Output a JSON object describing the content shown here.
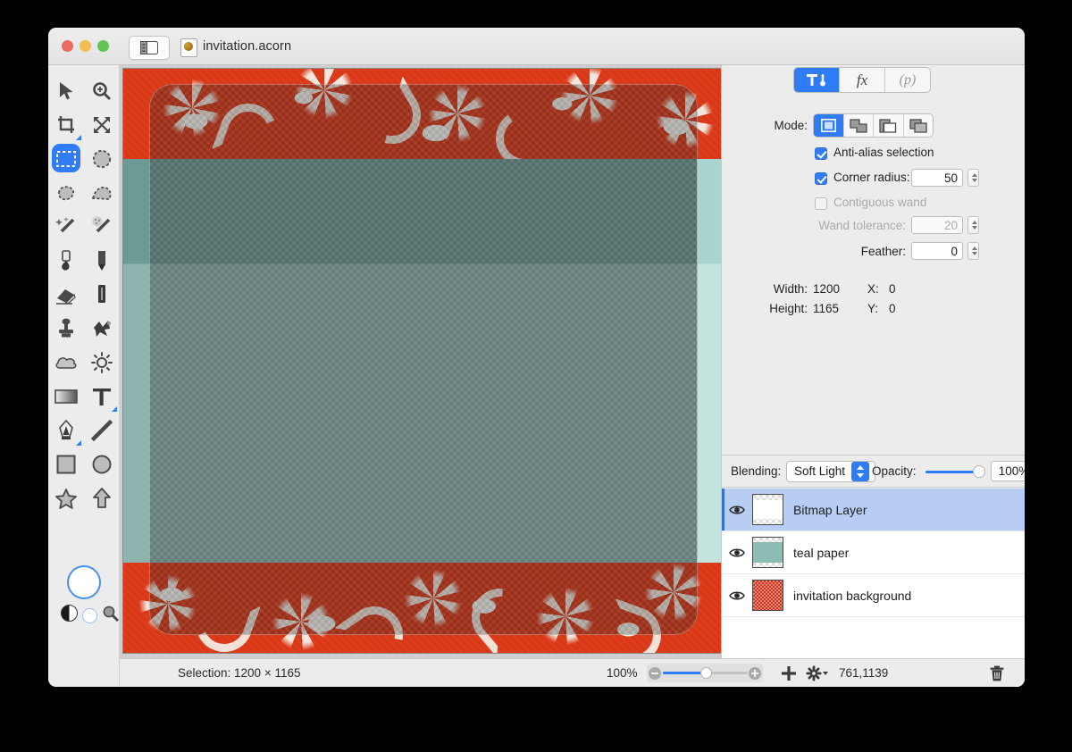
{
  "window": {
    "title": "invitation.acorn",
    "traffic_lights": [
      "close",
      "minimize",
      "maximize"
    ]
  },
  "tabs": [
    {
      "name": "tool-options-tab",
      "label": "",
      "icon": "tool-wrench-icon",
      "active": true
    },
    {
      "name": "filters-tab",
      "label": "fx",
      "icon": "fx-icon",
      "active": false
    },
    {
      "name": "palette-tab",
      "label": "(p)",
      "icon": "palette-icon",
      "active": false
    }
  ],
  "tools": [
    {
      "name": "move-tool",
      "icon": "arrow-cursor-icon",
      "active": false
    },
    {
      "name": "zoom-tool",
      "icon": "magnifier-plus-icon",
      "active": false
    },
    {
      "name": "crop-tool",
      "icon": "crop-icon",
      "active": false,
      "submenu": false
    },
    {
      "name": "transform-tool",
      "icon": "move-arrows-icon",
      "active": false
    },
    {
      "name": "rectangle-select-tool",
      "icon": "marquee-rect-icon",
      "active": true
    },
    {
      "name": "ellipse-select-tool",
      "icon": "marquee-ellipse-icon",
      "active": false
    },
    {
      "name": "lasso-tool",
      "icon": "lasso-icon",
      "active": false
    },
    {
      "name": "polygon-lasso-tool",
      "icon": "polygon-lasso-icon",
      "active": false
    },
    {
      "name": "magic-wand-tool",
      "icon": "magic-wand-icon",
      "active": false
    },
    {
      "name": "instant-alpha-tool",
      "icon": "instant-alpha-icon",
      "active": false
    },
    {
      "name": "paint-bucket-tool",
      "icon": "paint-bucket-icon",
      "active": false
    },
    {
      "name": "pencil-tool",
      "icon": "pencil-icon",
      "active": false
    },
    {
      "name": "eraser-tool",
      "icon": "eraser-icon",
      "active": false
    },
    {
      "name": "brush-tool",
      "icon": "brush-icon",
      "active": false
    },
    {
      "name": "clone-stamp-tool",
      "icon": "clone-stamp-icon",
      "active": false
    },
    {
      "name": "smudge-tool",
      "icon": "smudge-icon",
      "active": false
    },
    {
      "name": "blur-tool",
      "icon": "cloud-blur-icon",
      "active": false
    },
    {
      "name": "dodge-tool",
      "icon": "sun-dodge-icon",
      "active": false
    },
    {
      "name": "gradient-tool",
      "icon": "gradient-icon",
      "active": false
    },
    {
      "name": "text-tool",
      "icon": "text-t-icon",
      "active": false,
      "submenu": true
    },
    {
      "name": "pen-tool",
      "icon": "pen-nib-icon",
      "active": false,
      "submenu": true
    },
    {
      "name": "line-tool",
      "icon": "line-icon",
      "active": false
    },
    {
      "name": "rectangle-shape-tool",
      "icon": "rectangle-icon",
      "active": false
    },
    {
      "name": "ellipse-shape-tool",
      "icon": "ellipse-icon",
      "active": false
    },
    {
      "name": "star-shape-tool",
      "icon": "star-icon",
      "active": false
    },
    {
      "name": "arrow-shape-tool",
      "icon": "arrow-shape-icon",
      "active": false
    }
  ],
  "colors": {
    "foreground": "#ffffff",
    "background": "#ffffff",
    "accent": "#2f7cf6",
    "selection_blue": "#b8cdf4"
  },
  "inspector": {
    "mode_label": "Mode:",
    "modes": [
      {
        "name": "new-selection-mode",
        "active": true
      },
      {
        "name": "add-selection-mode",
        "active": false
      },
      {
        "name": "subtract-selection-mode",
        "active": false
      },
      {
        "name": "intersect-selection-mode",
        "active": false
      }
    ],
    "antialias": {
      "label": "Anti-alias selection",
      "checked": true,
      "enabled": true
    },
    "corner_radius": {
      "label": "Corner radius:",
      "checked": true,
      "value": "50",
      "enabled": true
    },
    "contiguous_wand": {
      "label": "Contiguous wand",
      "checked": false,
      "enabled": false
    },
    "wand_tolerance": {
      "label": "Wand tolerance:",
      "value": "20",
      "enabled": false
    },
    "feather": {
      "label": "Feather:",
      "value": "0",
      "enabled": true
    },
    "width": {
      "label": "Width:",
      "value": "1200"
    },
    "height": {
      "label": "Height:",
      "value": "1165"
    },
    "x": {
      "label": "X:",
      "value": "0"
    },
    "y": {
      "label": "Y:",
      "value": "0"
    }
  },
  "layers_panel": {
    "blending_label": "Blending:",
    "blending_value": "Soft Light",
    "opacity_label": "Opacity:",
    "opacity_value": "100%",
    "opacity_percent": 100,
    "layers": [
      {
        "name": "Bitmap Layer",
        "visible": true,
        "selected": true,
        "thumb": "transparent-white"
      },
      {
        "name": "teal paper",
        "visible": true,
        "selected": false,
        "thumb": "teal"
      },
      {
        "name": "invitation background",
        "visible": true,
        "selected": false,
        "thumb": "red-texture"
      }
    ]
  },
  "statusbar": {
    "selection_text": "Selection: 1200 × 1165",
    "zoom_text": "100%",
    "coords_text": "761,1139",
    "add_layer_icon": "plus-icon",
    "gear_icon": "gear-chevron-icon",
    "trash_icon": "trash-icon"
  },
  "canvas": {
    "background_color": "#e03c1a",
    "teal_color": "#8fb3ae",
    "selection_radius_px": 26
  }
}
